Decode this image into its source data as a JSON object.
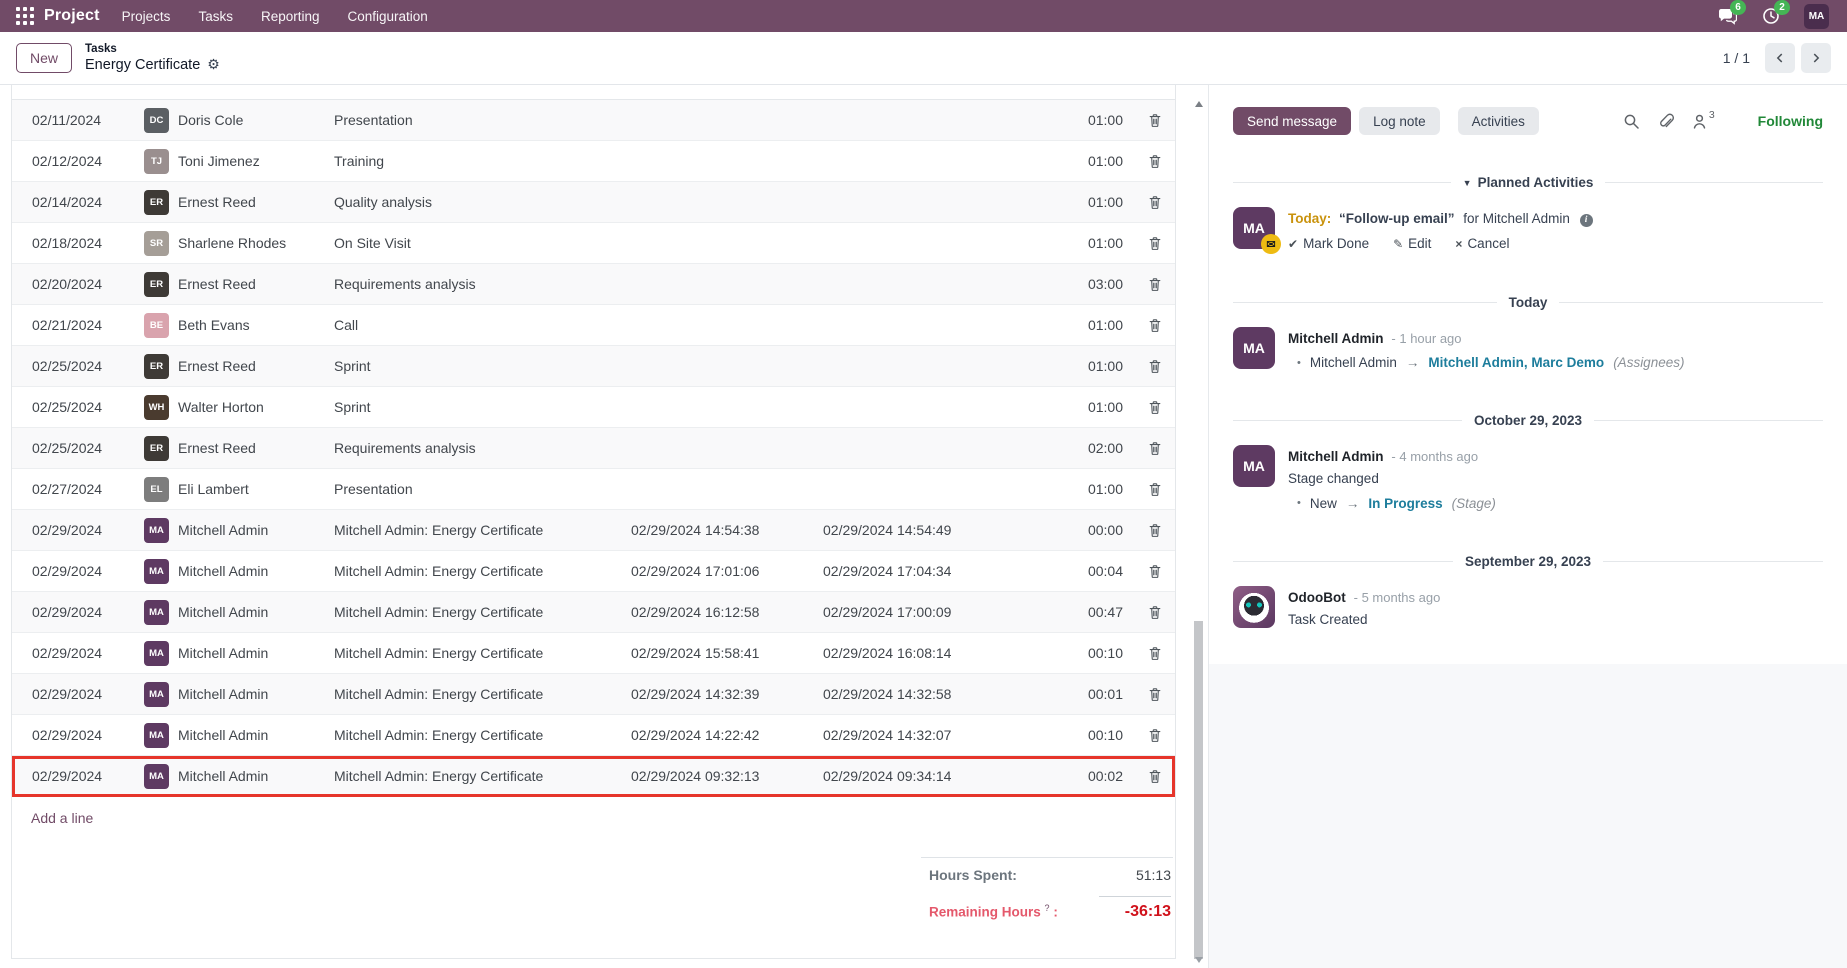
{
  "navbar": {
    "app_name": "Project",
    "menus": [
      "Projects",
      "Tasks",
      "Reporting",
      "Configuration"
    ],
    "messages_badge": "6",
    "activities_badge": "2",
    "user_initials": "MA"
  },
  "breadcrumb": {
    "new_button": "New",
    "parent": "Tasks",
    "current": "Energy Certificate",
    "pager_value": "1 / 1"
  },
  "timesheet": {
    "rows": [
      {
        "date": "02/11/2024",
        "person": "Doris Cole",
        "description": "Presentation",
        "start": "",
        "end": "",
        "duration": "01:00",
        "highlighted": false
      },
      {
        "date": "02/12/2024",
        "person": "Toni Jimenez",
        "description": "Training",
        "start": "",
        "end": "",
        "duration": "01:00",
        "highlighted": false
      },
      {
        "date": "02/14/2024",
        "person": "Ernest Reed",
        "description": "Quality analysis",
        "start": "",
        "end": "",
        "duration": "01:00",
        "highlighted": false
      },
      {
        "date": "02/18/2024",
        "person": "Sharlene Rhodes",
        "description": "On Site Visit",
        "start": "",
        "end": "",
        "duration": "01:00",
        "highlighted": false
      },
      {
        "date": "02/20/2024",
        "person": "Ernest Reed",
        "description": "Requirements analysis",
        "start": "",
        "end": "",
        "duration": "03:00",
        "highlighted": false
      },
      {
        "date": "02/21/2024",
        "person": "Beth Evans",
        "description": "Call",
        "start": "",
        "end": "",
        "duration": "01:00",
        "highlighted": false
      },
      {
        "date": "02/25/2024",
        "person": "Ernest Reed",
        "description": "Sprint",
        "start": "",
        "end": "",
        "duration": "01:00",
        "highlighted": false
      },
      {
        "date": "02/25/2024",
        "person": "Walter Horton",
        "description": "Sprint",
        "start": "",
        "end": "",
        "duration": "01:00",
        "highlighted": false
      },
      {
        "date": "02/25/2024",
        "person": "Ernest Reed",
        "description": "Requirements analysis",
        "start": "",
        "end": "",
        "duration": "02:00",
        "highlighted": false
      },
      {
        "date": "02/27/2024",
        "person": "Eli Lambert",
        "description": "Presentation",
        "start": "",
        "end": "",
        "duration": "01:00",
        "highlighted": false
      },
      {
        "date": "02/29/2024",
        "person": "Mitchell Admin",
        "description": "Mitchell Admin: Energy Certificate",
        "start": "02/29/2024 14:54:38",
        "end": "02/29/2024 14:54:49",
        "duration": "00:00",
        "highlighted": false
      },
      {
        "date": "02/29/2024",
        "person": "Mitchell Admin",
        "description": "Mitchell Admin: Energy Certificate",
        "start": "02/29/2024 17:01:06",
        "end": "02/29/2024 17:04:34",
        "duration": "00:04",
        "highlighted": false
      },
      {
        "date": "02/29/2024",
        "person": "Mitchell Admin",
        "description": "Mitchell Admin: Energy Certificate",
        "start": "02/29/2024 16:12:58",
        "end": "02/29/2024 17:00:09",
        "duration": "00:47",
        "highlighted": false
      },
      {
        "date": "02/29/2024",
        "person": "Mitchell Admin",
        "description": "Mitchell Admin: Energy Certificate",
        "start": "02/29/2024 15:58:41",
        "end": "02/29/2024 16:08:14",
        "duration": "00:10",
        "highlighted": false
      },
      {
        "date": "02/29/2024",
        "person": "Mitchell Admin",
        "description": "Mitchell Admin: Energy Certificate",
        "start": "02/29/2024 14:32:39",
        "end": "02/29/2024 14:32:58",
        "duration": "00:01",
        "highlighted": false
      },
      {
        "date": "02/29/2024",
        "person": "Mitchell Admin",
        "description": "Mitchell Admin: Energy Certificate",
        "start": "02/29/2024 14:22:42",
        "end": "02/29/2024 14:32:07",
        "duration": "00:10",
        "highlighted": false
      },
      {
        "date": "02/29/2024",
        "person": "Mitchell Admin",
        "description": "Mitchell Admin: Energy Certificate",
        "start": "02/29/2024 09:32:13",
        "end": "02/29/2024 09:34:14",
        "duration": "00:02",
        "highlighted": true
      }
    ],
    "add_line_label": "Add a line",
    "totals": {
      "hours_spent_label": "Hours Spent:",
      "hours_spent_value": "51:13",
      "remaining_label": "Remaining Hours",
      "remaining_help": "?",
      "remaining_colon": ":",
      "remaining_value": "-36:13"
    }
  },
  "chatter": {
    "buttons": {
      "send": "Send message",
      "log": "Log note",
      "activities": "Activities"
    },
    "followers_count": "3",
    "following_label": "Following",
    "planned": {
      "section_title": "Planned Activities",
      "due_label": "Today:",
      "summary": "“Follow-up email”",
      "for_text": "for Mitchell Admin",
      "actions": {
        "done": "Mark Done",
        "edit": "Edit",
        "cancel": "Cancel"
      }
    },
    "threads": [
      {
        "divider": "Today",
        "messages": [
          {
            "author": "Mitchell Admin",
            "time": "- 1 hour ago",
            "body": "",
            "tracking": {
              "old": "Mitchell Admin",
              "new": "Mitchell Admin, Marc Demo",
              "field": "(Assignees)"
            }
          }
        ]
      },
      {
        "divider": "October 29, 2023",
        "messages": [
          {
            "author": "Mitchell Admin",
            "time": "- 4 months ago",
            "body": "Stage changed",
            "tracking": {
              "old": "New",
              "new": "In Progress",
              "field": "(Stage)"
            }
          }
        ]
      },
      {
        "divider": "September 29, 2023",
        "messages": [
          {
            "author": "OdooBot",
            "time": "- 5 months ago",
            "body": "Task Created",
            "tracking": null
          }
        ]
      }
    ]
  },
  "colors": {
    "navbar_bg": "#714B67",
    "primary_button": "#714B67",
    "badge_green": "#45b555",
    "following_green": "#218838",
    "link_teal": "#1d7d9c",
    "warning_gold": "#c9920c",
    "danger_pink": "#e4586b",
    "danger_red": "#d0111b",
    "highlight_border": "#e6352b",
    "avatars": {
      "Doris Cole": "#5b5f63",
      "Toni Jimenez": "#9a8f8f",
      "Ernest Reed": "#3e3a36",
      "Sharlene Rhodes": "#a59e97",
      "Beth Evans": "#d9a3ad",
      "Walter Horton": "#4a3b2f",
      "Eli Lambert": "#7d7d7d",
      "Mitchell Admin": "#5e3a62",
      "OdooBot": "#5e3a62"
    }
  }
}
